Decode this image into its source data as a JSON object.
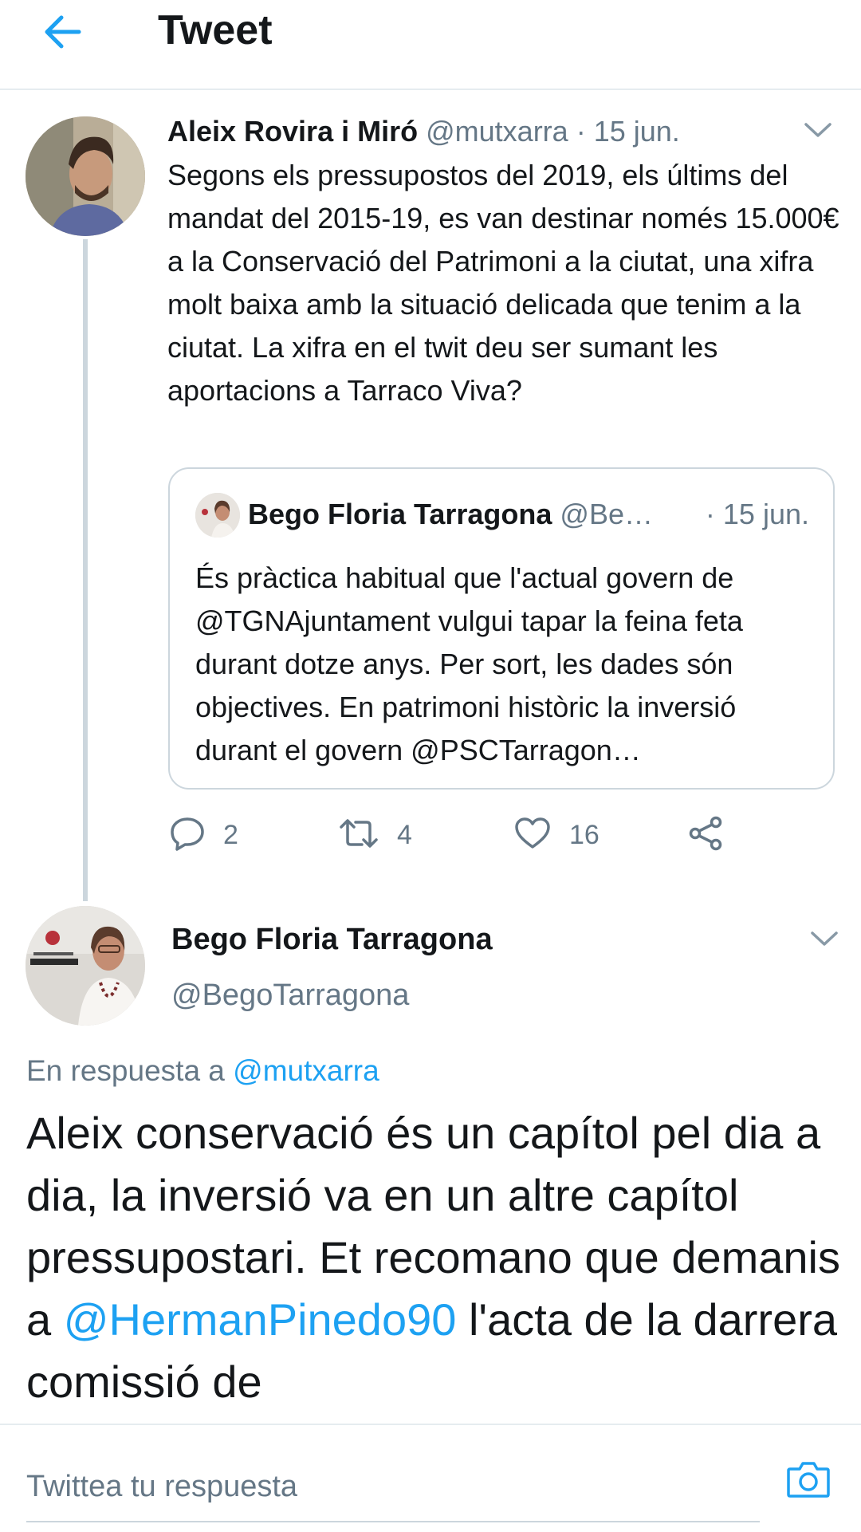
{
  "header": {
    "title": "Tweet",
    "back_icon": "back-arrow-icon"
  },
  "colors": {
    "accent": "#1da1f2",
    "muted": "#657786",
    "text": "#14171a",
    "divider": "#e6ecf0"
  },
  "tweet": {
    "author_name": "Aleix Rovira i Miró",
    "author_handle": "@mutxarra",
    "separator": " · ",
    "date": "15 jun.",
    "text": "Segons els pressupostos del 2019, els últims del mandat del 2015-19, es van destinar només 15.000€ a la Conservació del Patrimoni a la ciutat, una xifra molt baixa amb la situació delicada que tenim a la ciutat. La xifra en el twit deu ser sumant les aportacions a Tarraco Viva?",
    "quote": {
      "author_name": "Bego Floria Tarragona",
      "author_handle": "@Be…",
      "date": "· 15 jun.",
      "text": "És pràctica habitual que l'actual govern de @TGNAjuntament vulgui tapar la feina feta durant dotze anys. Per sort, les dades són objectives. En patrimoni històric la inversió durant el govern @PSCTarragon…"
    },
    "actions": {
      "replies": "2",
      "retweets": "4",
      "likes": "16"
    }
  },
  "reply": {
    "author_name": "Bego Floria Tarragona",
    "author_handle": "@BegoTarragona",
    "replying_prefix": "En respuesta a ",
    "replying_handle": "@mutxarra",
    "text_part1": "Aleix conservació és un capítol pel dia a dia, la inversió va en un altre capítol pressupostari. Et recomano que demanis a ",
    "mention": "@HermanPinedo90",
    "text_part2": " l'acta de la darrera comissió de"
  },
  "compose": {
    "placeholder": "Twittea tu respuesta",
    "camera_icon": "camera-icon"
  }
}
